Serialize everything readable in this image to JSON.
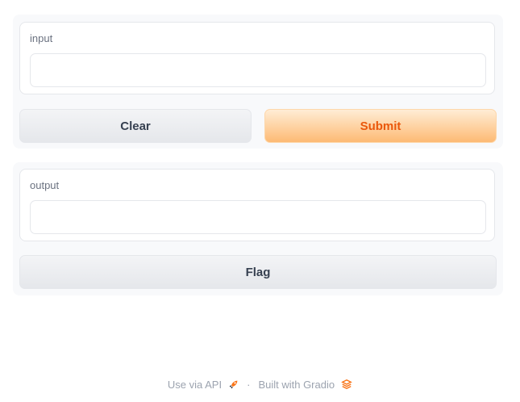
{
  "input_panel": {
    "label": "input",
    "value": "",
    "clear_label": "Clear",
    "submit_label": "Submit"
  },
  "output_panel": {
    "label": "output",
    "value": "",
    "flag_label": "Flag"
  },
  "footer": {
    "api_label": "Use via API",
    "separator": "·",
    "built_label": "Built with Gradio"
  },
  "colors": {
    "accent": "#ea580c",
    "accent_bg": "#fdba74",
    "panel_bg": "#f8f9fb"
  },
  "icons": {
    "api": "rocket-icon",
    "gradio": "gradio-logo-icon"
  }
}
